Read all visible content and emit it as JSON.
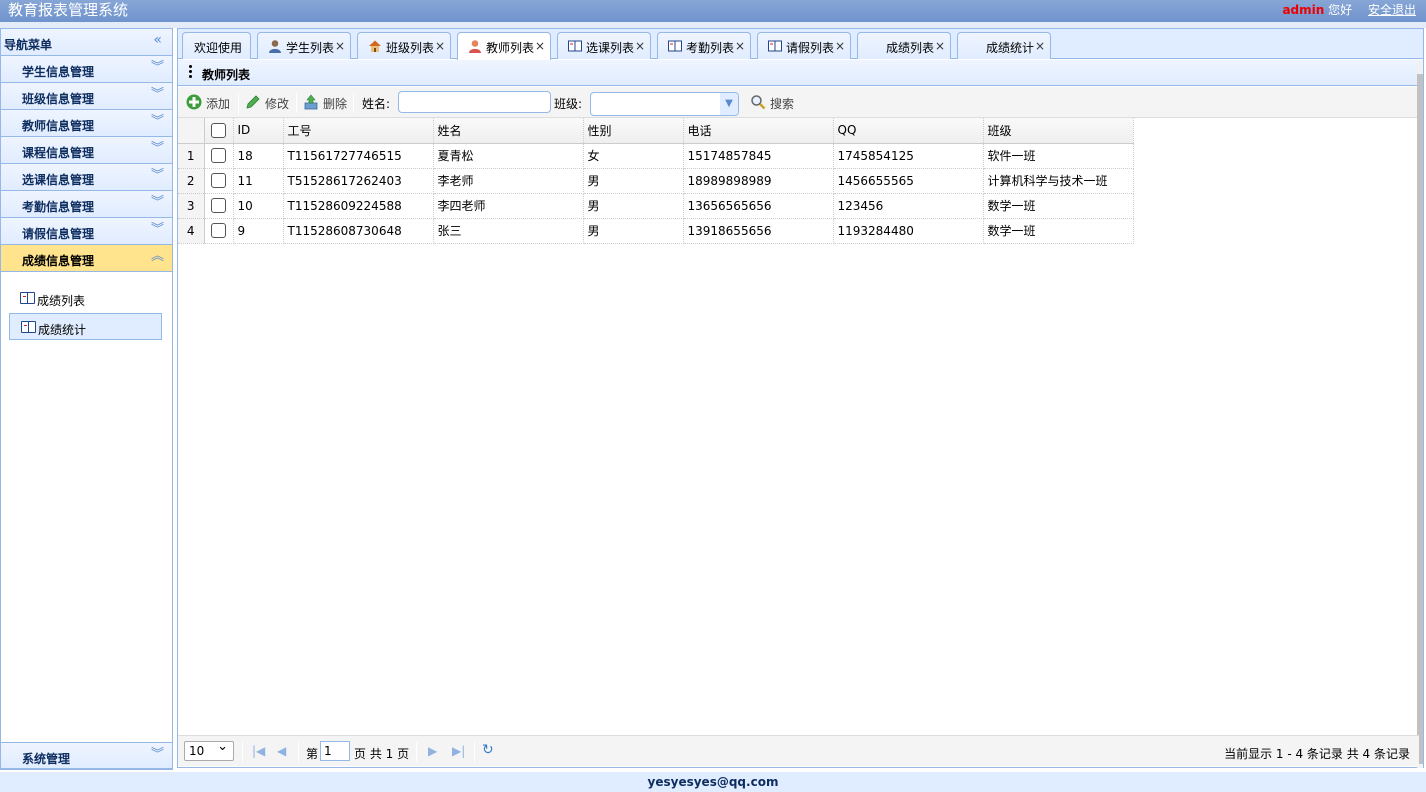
{
  "header": {
    "title": "教育报表管理系统",
    "user": "admin",
    "greeting": "您好",
    "logout": "安全退出"
  },
  "nav": {
    "title": "导航菜单",
    "collapse_icon": "double-chevron-left",
    "menus": [
      "学生信息管理",
      "班级信息管理",
      "教师信息管理",
      "课程信息管理",
      "选课信息管理",
      "考勤信息管理",
      "请假信息管理",
      "成绩信息管理"
    ],
    "active_menu": "成绩信息管理",
    "sub_items": [
      "成绩列表",
      "成绩统计"
    ],
    "selected_sub_item": "成绩统计",
    "bottom_menu": "系统管理"
  },
  "tabs": [
    {
      "label": "欢迎使用",
      "closable": false,
      "icon": ""
    },
    {
      "label": "学生列表",
      "closable": true,
      "icon": "user-icon"
    },
    {
      "label": "班级列表",
      "closable": true,
      "icon": "house-icon"
    },
    {
      "label": "教师列表",
      "closable": true,
      "icon": "teacher-icon"
    },
    {
      "label": "选课列表",
      "closable": true,
      "icon": "book-icon"
    },
    {
      "label": "考勤列表",
      "closable": true,
      "icon": "book-icon"
    },
    {
      "label": "请假列表",
      "closable": true,
      "icon": "book-icon"
    },
    {
      "label": "成绩列表",
      "closable": true,
      "icon": ""
    },
    {
      "label": "成绩统计",
      "closable": true,
      "icon": ""
    }
  ],
  "active_tab": "教师列表",
  "panel": {
    "title": "教师列表"
  },
  "toolbar": {
    "add": "添加",
    "edit": "修改",
    "delete": "删除",
    "name_label": "姓名:",
    "name_value": "",
    "class_label": "班级:",
    "class_value": "",
    "search": "搜索"
  },
  "table": {
    "columns": [
      "ID",
      "工号",
      "姓名",
      "性别",
      "电话",
      "QQ",
      "班级"
    ],
    "rows": [
      {
        "n": "1",
        "id": "18",
        "no": "T11561727746515",
        "name": "夏青松",
        "sex": "女",
        "phone": "15174857845",
        "qq": "1745854125",
        "cls": "软件一班"
      },
      {
        "n": "2",
        "id": "11",
        "no": "T51528617262403",
        "name": "李老师",
        "sex": "男",
        "phone": "18989898989",
        "qq": "1456655565",
        "cls": "计算机科学与技术一班"
      },
      {
        "n": "3",
        "id": "10",
        "no": "T11528609224588",
        "name": "李四老师",
        "sex": "男",
        "phone": "13656565656",
        "qq": "123456",
        "cls": "数学一班"
      },
      {
        "n": "4",
        "id": "9",
        "no": "T11528608730648",
        "name": "张三",
        "sex": "男",
        "phone": "13918655656",
        "qq": "1193284480",
        "cls": "数学一班"
      }
    ]
  },
  "pager": {
    "page_size": "10",
    "page_prefix": "第",
    "page_number": "1",
    "page_suffix": "页 共 1 页",
    "info": "当前显示 1 - 4 条记录 共 4 条记录"
  },
  "footer": {
    "text": "yesyesyes@qq.com"
  }
}
